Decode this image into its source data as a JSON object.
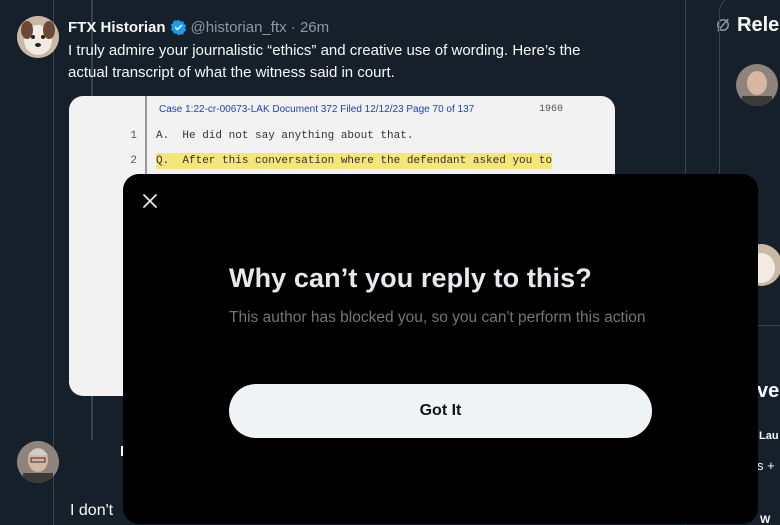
{
  "tweet": {
    "author_name": "FTX Historian",
    "handle_meta": "@historian_ftx · 26m",
    "text": "I truly admire your journalistic “ethics” and creative use of wording. Here’s the actual transcript of what the witness said in court."
  },
  "document": {
    "header": "Case 1:22-cr-00673-LAK   Document 372   Filed 12/12/23   Page 70 of 137",
    "page_no": "1960",
    "lines": [
      {
        "num": "1",
        "text": "A.  He did not say anything about that."
      },
      {
        "num": "2",
        "text": "Q.  After this conversation where the defendant asked you to"
      }
    ]
  },
  "reply": {
    "text": "I don't",
    "initial": "I"
  },
  "sidebar": {
    "title": "Rele",
    "section2": "ve",
    "name_fragment": "Lau",
    "s_fragment": "s +",
    "w_fragment": "W"
  },
  "modal": {
    "title": "Why can’t you reply to this?",
    "body": "This author has blocked you, so you can't perform this action",
    "button": "Got It"
  },
  "colors": {
    "background": "#15202b",
    "modal": "#000000",
    "verified": "#1d9bf0",
    "button": "#eff3f4"
  }
}
